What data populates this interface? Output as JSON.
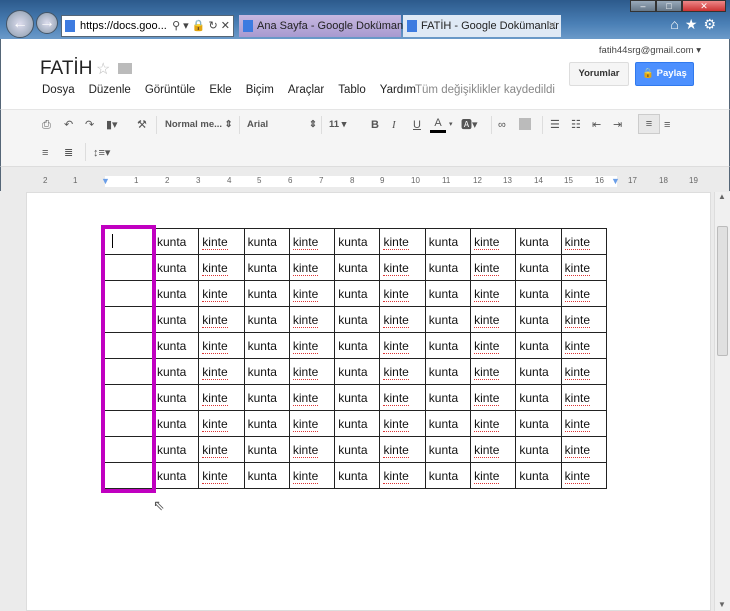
{
  "browser": {
    "address": "https://docs.goo...",
    "tabs": [
      {
        "label": "Ana Sayfa - Google Dokümanlar",
        "active": false
      },
      {
        "label": "FATİH - Google Dokümanlar",
        "active": true
      }
    ],
    "window_buttons": [
      "minimize",
      "maximize",
      "close"
    ]
  },
  "doc": {
    "title": "FATİH",
    "account": "fatih44srg@gmail.com",
    "comments_label": "Yorumlar",
    "share_label": "Paylaş",
    "menu": [
      "Dosya",
      "Düzenle",
      "Görüntüle",
      "Ekle",
      "Biçim",
      "Araçlar",
      "Tablo",
      "Yardım"
    ],
    "save_status": "Tüm değişiklikler kaydedildi"
  },
  "toolbar": {
    "style": "Normal me...",
    "font": "Arial",
    "size": "11",
    "accent": "#4d90fe"
  },
  "ruler": {
    "labels": [
      "2",
      "1",
      "1",
      "2",
      "3",
      "4",
      "5",
      "6",
      "7",
      "8",
      "9",
      "10",
      "11",
      "12",
      "13",
      "14",
      "15",
      "16",
      "17",
      "18",
      "19"
    ]
  },
  "table": {
    "selection_color": "#c000c0",
    "rows": [
      [
        "",
        "kunta",
        "kinte",
        "kunta",
        "kinte",
        "kunta",
        "kinte",
        "kunta",
        "kinte",
        "kunta",
        "kinte"
      ],
      [
        "",
        "kunta",
        "kinte",
        "kunta",
        "kinte",
        "kunta",
        "kinte",
        "kunta",
        "kinte",
        "kunta",
        "kinte"
      ],
      [
        "",
        "kunta",
        "kinte",
        "kunta",
        "kinte",
        "kunta",
        "kinte",
        "kunta",
        "kinte",
        "kunta",
        "kinte"
      ],
      [
        "",
        "kunta",
        "kinte",
        "kunta",
        "kinte",
        "kunta",
        "kinte",
        "kunta",
        "kinte",
        "kunta",
        "kinte"
      ],
      [
        "",
        "kunta",
        "kinte",
        "kunta",
        "kinte",
        "kunta",
        "kinte",
        "kunta",
        "kinte",
        "kunta",
        "kinte"
      ],
      [
        "",
        "kunta",
        "kinte",
        "kunta",
        "kinte",
        "kunta",
        "kinte",
        "kunta",
        "kinte",
        "kunta",
        "kinte"
      ],
      [
        "",
        "kunta",
        "kinte",
        "kunta",
        "kinte",
        "kunta",
        "kinte",
        "kunta",
        "kinte",
        "kunta",
        "kinte"
      ],
      [
        "",
        "kunta",
        "kinte",
        "kunta",
        "kinte",
        "kunta",
        "kinte",
        "kunta",
        "kinte",
        "kunta",
        "kinte"
      ],
      [
        "",
        "kunta",
        "kinte",
        "kunta",
        "kinte",
        "kunta",
        "kinte",
        "kunta",
        "kinte",
        "kunta",
        "kinte"
      ],
      [
        "",
        "kunta",
        "kinte",
        "kunta",
        "kinte",
        "kunta",
        "kinte",
        "kunta",
        "kinte",
        "kunta",
        "kinte"
      ]
    ]
  }
}
